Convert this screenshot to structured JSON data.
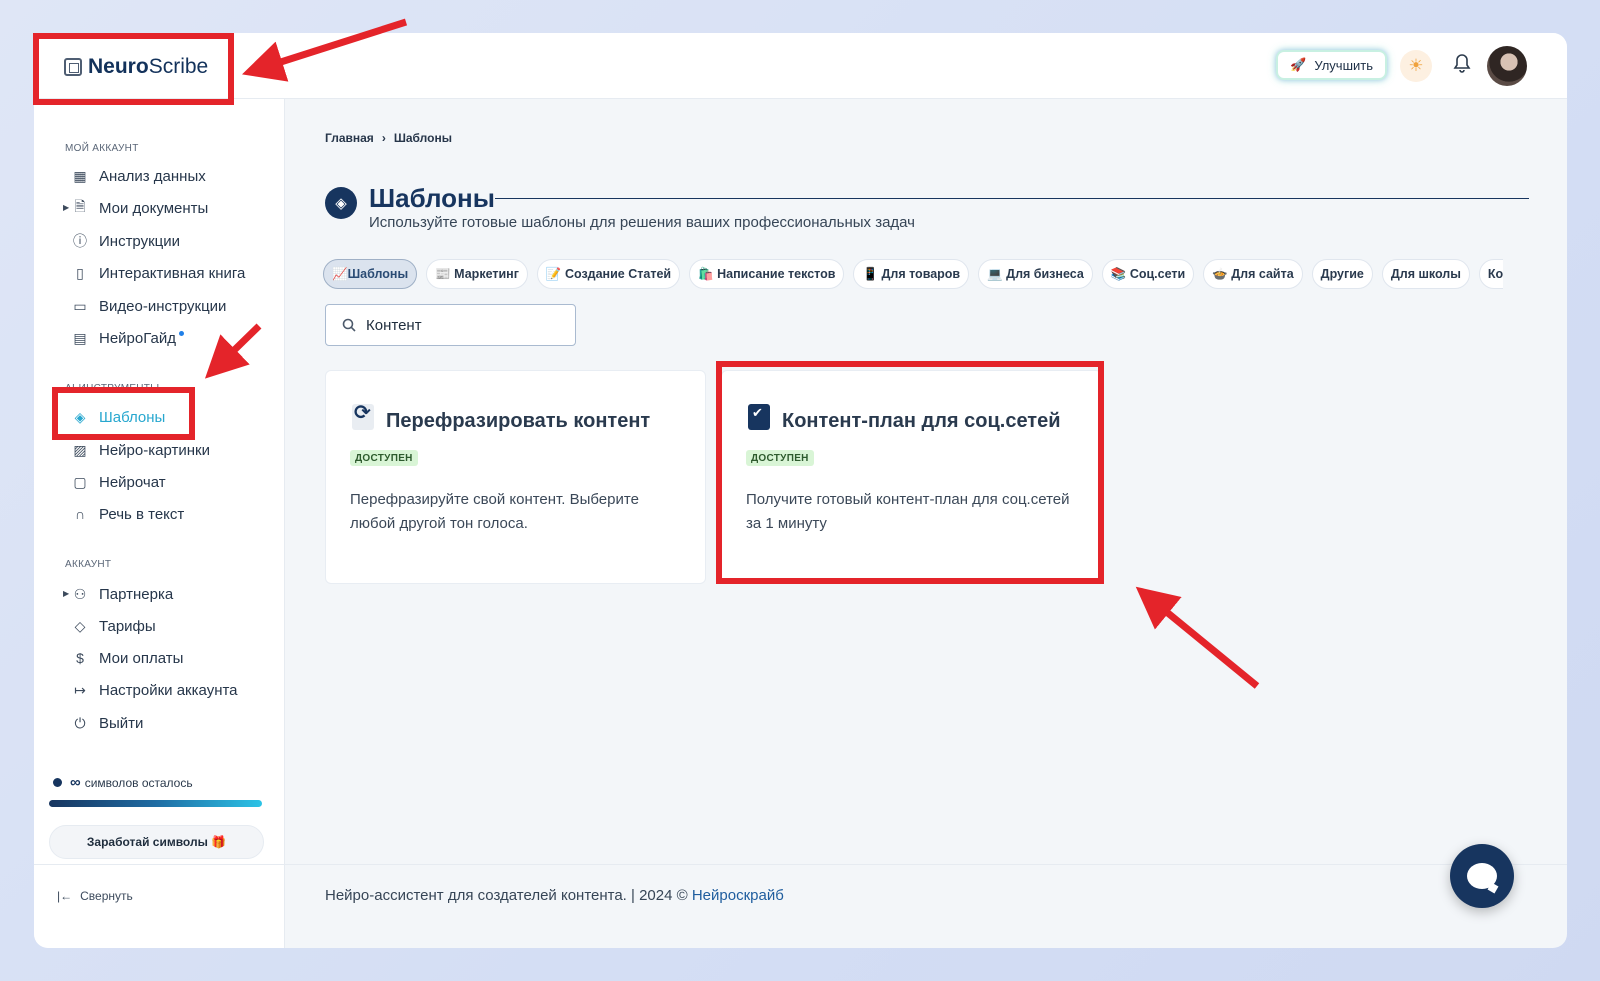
{
  "app": {
    "logo_bold": "Neuro",
    "logo_rest": "Scribe"
  },
  "topbar": {
    "upgrade_label": "Улучшить"
  },
  "sidebar": {
    "section_my_account": "МОЙ АККАУНТ",
    "section_ai_tools": "AI-ИНСТРУМЕНТЫ",
    "section_account": "АККАУНТ",
    "items": [
      {
        "label": "Анализ данных",
        "icon": "grid-icon"
      },
      {
        "label": "Мои документы",
        "icon": "document-icon"
      },
      {
        "label": "Инструкции",
        "icon": "help-icon"
      },
      {
        "label": "Интерактивная книга",
        "icon": "book-icon"
      },
      {
        "label": "Видео-инструкции",
        "icon": "video-icon"
      },
      {
        "label": "НейроГайд",
        "icon": "guide-icon"
      },
      {
        "label": "Шаблоны",
        "icon": "layers-icon"
      },
      {
        "label": "Нейро-картинки",
        "icon": "image-icon"
      },
      {
        "label": "Нейрочат",
        "icon": "chat-icon"
      },
      {
        "label": "Речь в текст",
        "icon": "headphones-icon"
      },
      {
        "label": "Партнерка",
        "icon": "users-icon"
      },
      {
        "label": "Тарифы",
        "icon": "tag-icon"
      },
      {
        "label": "Мои оплаты",
        "icon": "dollar-icon"
      },
      {
        "label": "Настройки аккаунта",
        "icon": "logout-icon"
      },
      {
        "label": "Выйти",
        "icon": "power-icon"
      }
    ],
    "credits_symbol": "∞",
    "credits_text": "символов осталось",
    "earn_label": "Заработай символы 🎁",
    "collapse_label": "Свернуть"
  },
  "breadcrumb": {
    "home": "Главная",
    "current": "Шаблоны"
  },
  "page": {
    "title": "Шаблоны",
    "subtitle": "Используйте готовые шаблоны для решения ваших профессиональных задач"
  },
  "chips": [
    "📈Шаблоны",
    "📰 Маркетинг",
    "📝 Создание Статей",
    "🛍️ Написание текстов",
    "📱 Для товаров",
    "💻 Для бизнеса",
    "📚 Соц.сети",
    "🍲 Для сайта",
    "Другие",
    "Для школы",
    "Копи"
  ],
  "search": {
    "value": "Контент"
  },
  "cards": [
    {
      "title": "Перефразировать контент",
      "badge": "ДОСТУПЕН",
      "desc": "Перефразируйте свой контент. Выберите любой другой тон голоса.",
      "icon": "refresh-icon"
    },
    {
      "title": "Контент-план для соц.сетей",
      "badge": "ДОСТУПЕН",
      "desc": "Получите готовый контент-план для соц.сетей за 1 минуту",
      "icon": "checkbox-icon"
    }
  ],
  "footer": {
    "text": "Нейро-ассистент для создателей контента.  | 2024 © ",
    "link": "Нейроскрайб"
  },
  "colors": {
    "accent": "#17355f",
    "active": "#27a7cf",
    "highlight": "#e4242a",
    "badge_bg": "#d9f5d6"
  }
}
